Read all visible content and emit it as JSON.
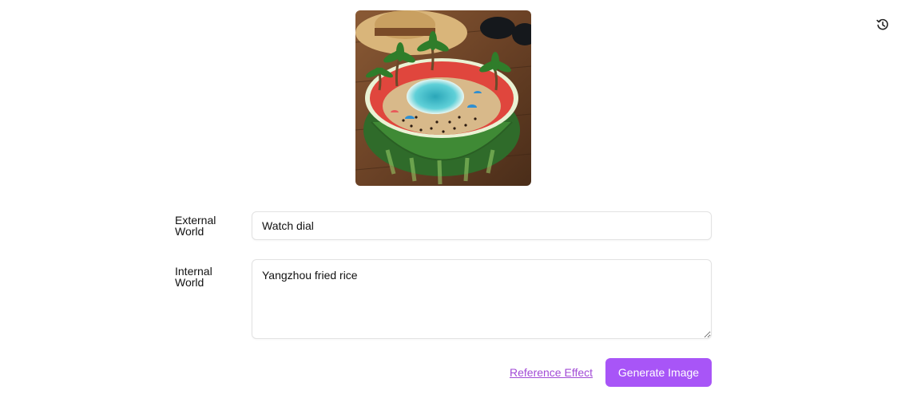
{
  "header": {
    "history_icon": "history-icon"
  },
  "preview": {
    "image_subject": "watermelon-beach-diorama"
  },
  "form": {
    "external_label": "External World",
    "external_value": "Watch dial",
    "internal_label": "Internal World",
    "internal_value": "Yangzhou fried rice"
  },
  "actions": {
    "reference_label": "Reference Effect",
    "generate_label": "Generate Image"
  },
  "colors": {
    "accent": "#a855f7",
    "link": "#a24bd6",
    "border": "#e2e2e2"
  }
}
